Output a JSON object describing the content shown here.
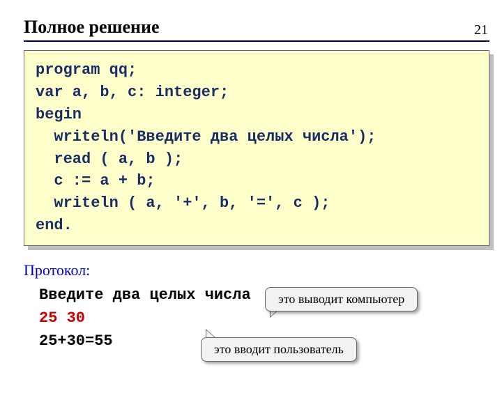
{
  "page_number": "21",
  "title": "Полное решение",
  "code": "program qq;\nvar a, b, c: integer;\nbegin\n  writeln('Введите два целых числа');\n  read ( a, b );\n  c := a + b;\n  writeln ( a, '+', b, '=', c );\nend.",
  "protocol": {
    "label": "Протокол:",
    "output_prompt": "Введите два целых числа",
    "user_input": "25 30",
    "result": "25+30=55"
  },
  "callouts": {
    "computer_outputs": "это выводит компьютер",
    "user_inputs": "это вводит пользователь"
  }
}
